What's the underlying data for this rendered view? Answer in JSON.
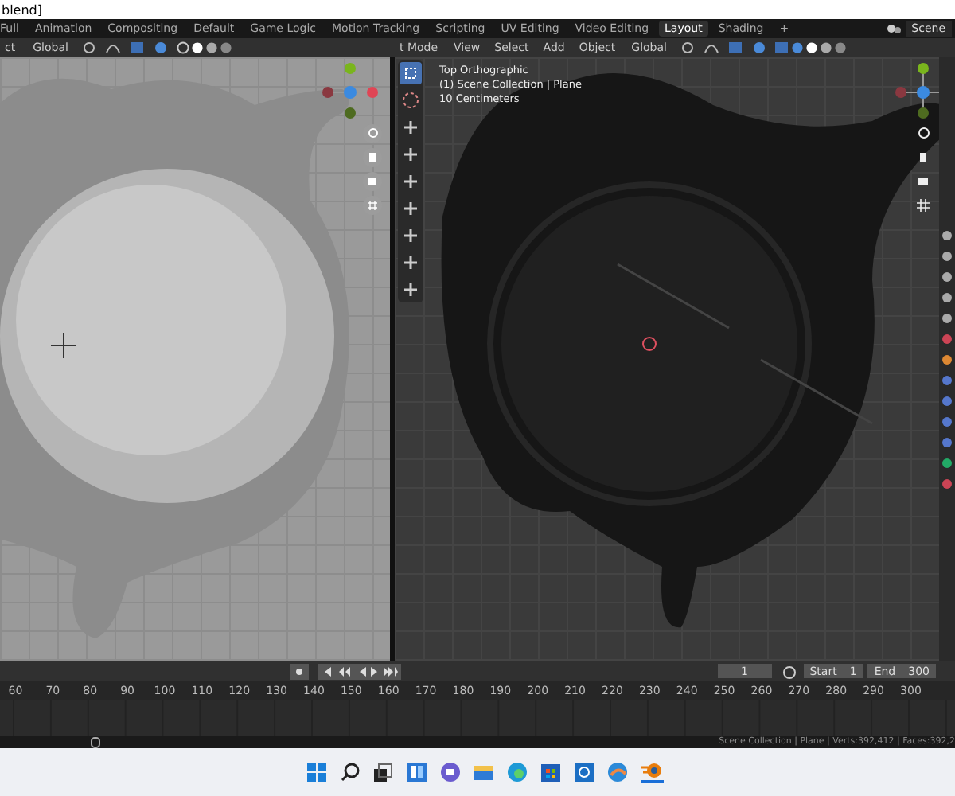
{
  "title_bar": {
    "title": "blend]"
  },
  "workspaces": [
    {
      "label": "Full",
      "selected": false
    },
    {
      "label": "Animation",
      "selected": false
    },
    {
      "label": "Compositing",
      "selected": false
    },
    {
      "label": "Default",
      "selected": false
    },
    {
      "label": "Game Logic",
      "selected": false
    },
    {
      "label": "Motion Tracking",
      "selected": false
    },
    {
      "label": "Scripting",
      "selected": false
    },
    {
      "label": "UV Editing",
      "selected": false
    },
    {
      "label": "Video Editing",
      "selected": false
    },
    {
      "label": "Layout",
      "selected": true
    },
    {
      "label": "Shading",
      "selected": false
    }
  ],
  "add_workspace": "+",
  "scene": {
    "label": "Scene"
  },
  "left_header": {
    "mode": "ct",
    "orientation": "Global"
  },
  "right_header": {
    "mode": "t Mode",
    "menus": [
      "View",
      "Select",
      "Add",
      "Object"
    ],
    "orientation": "Global"
  },
  "viewport": {
    "view": "Top Orthographic",
    "collection": "(1) Scene Collection | Plane",
    "scale": "10 Centimeters"
  },
  "timeline": {
    "current_frame": "1",
    "start_label": "Start",
    "start": "1",
    "end_label": "End",
    "end": "300",
    "ruler": [
      "60",
      "70",
      "80",
      "90",
      "100",
      "110",
      "120",
      "130",
      "140",
      "150",
      "160",
      "170",
      "180",
      "190",
      "200",
      "210",
      "220",
      "230",
      "240",
      "250",
      "260",
      "270",
      "280",
      "290",
      "300"
    ]
  },
  "status_bar": {
    "text": "Scene Collection | Plane | Verts:392,412 | Faces:392,2"
  }
}
